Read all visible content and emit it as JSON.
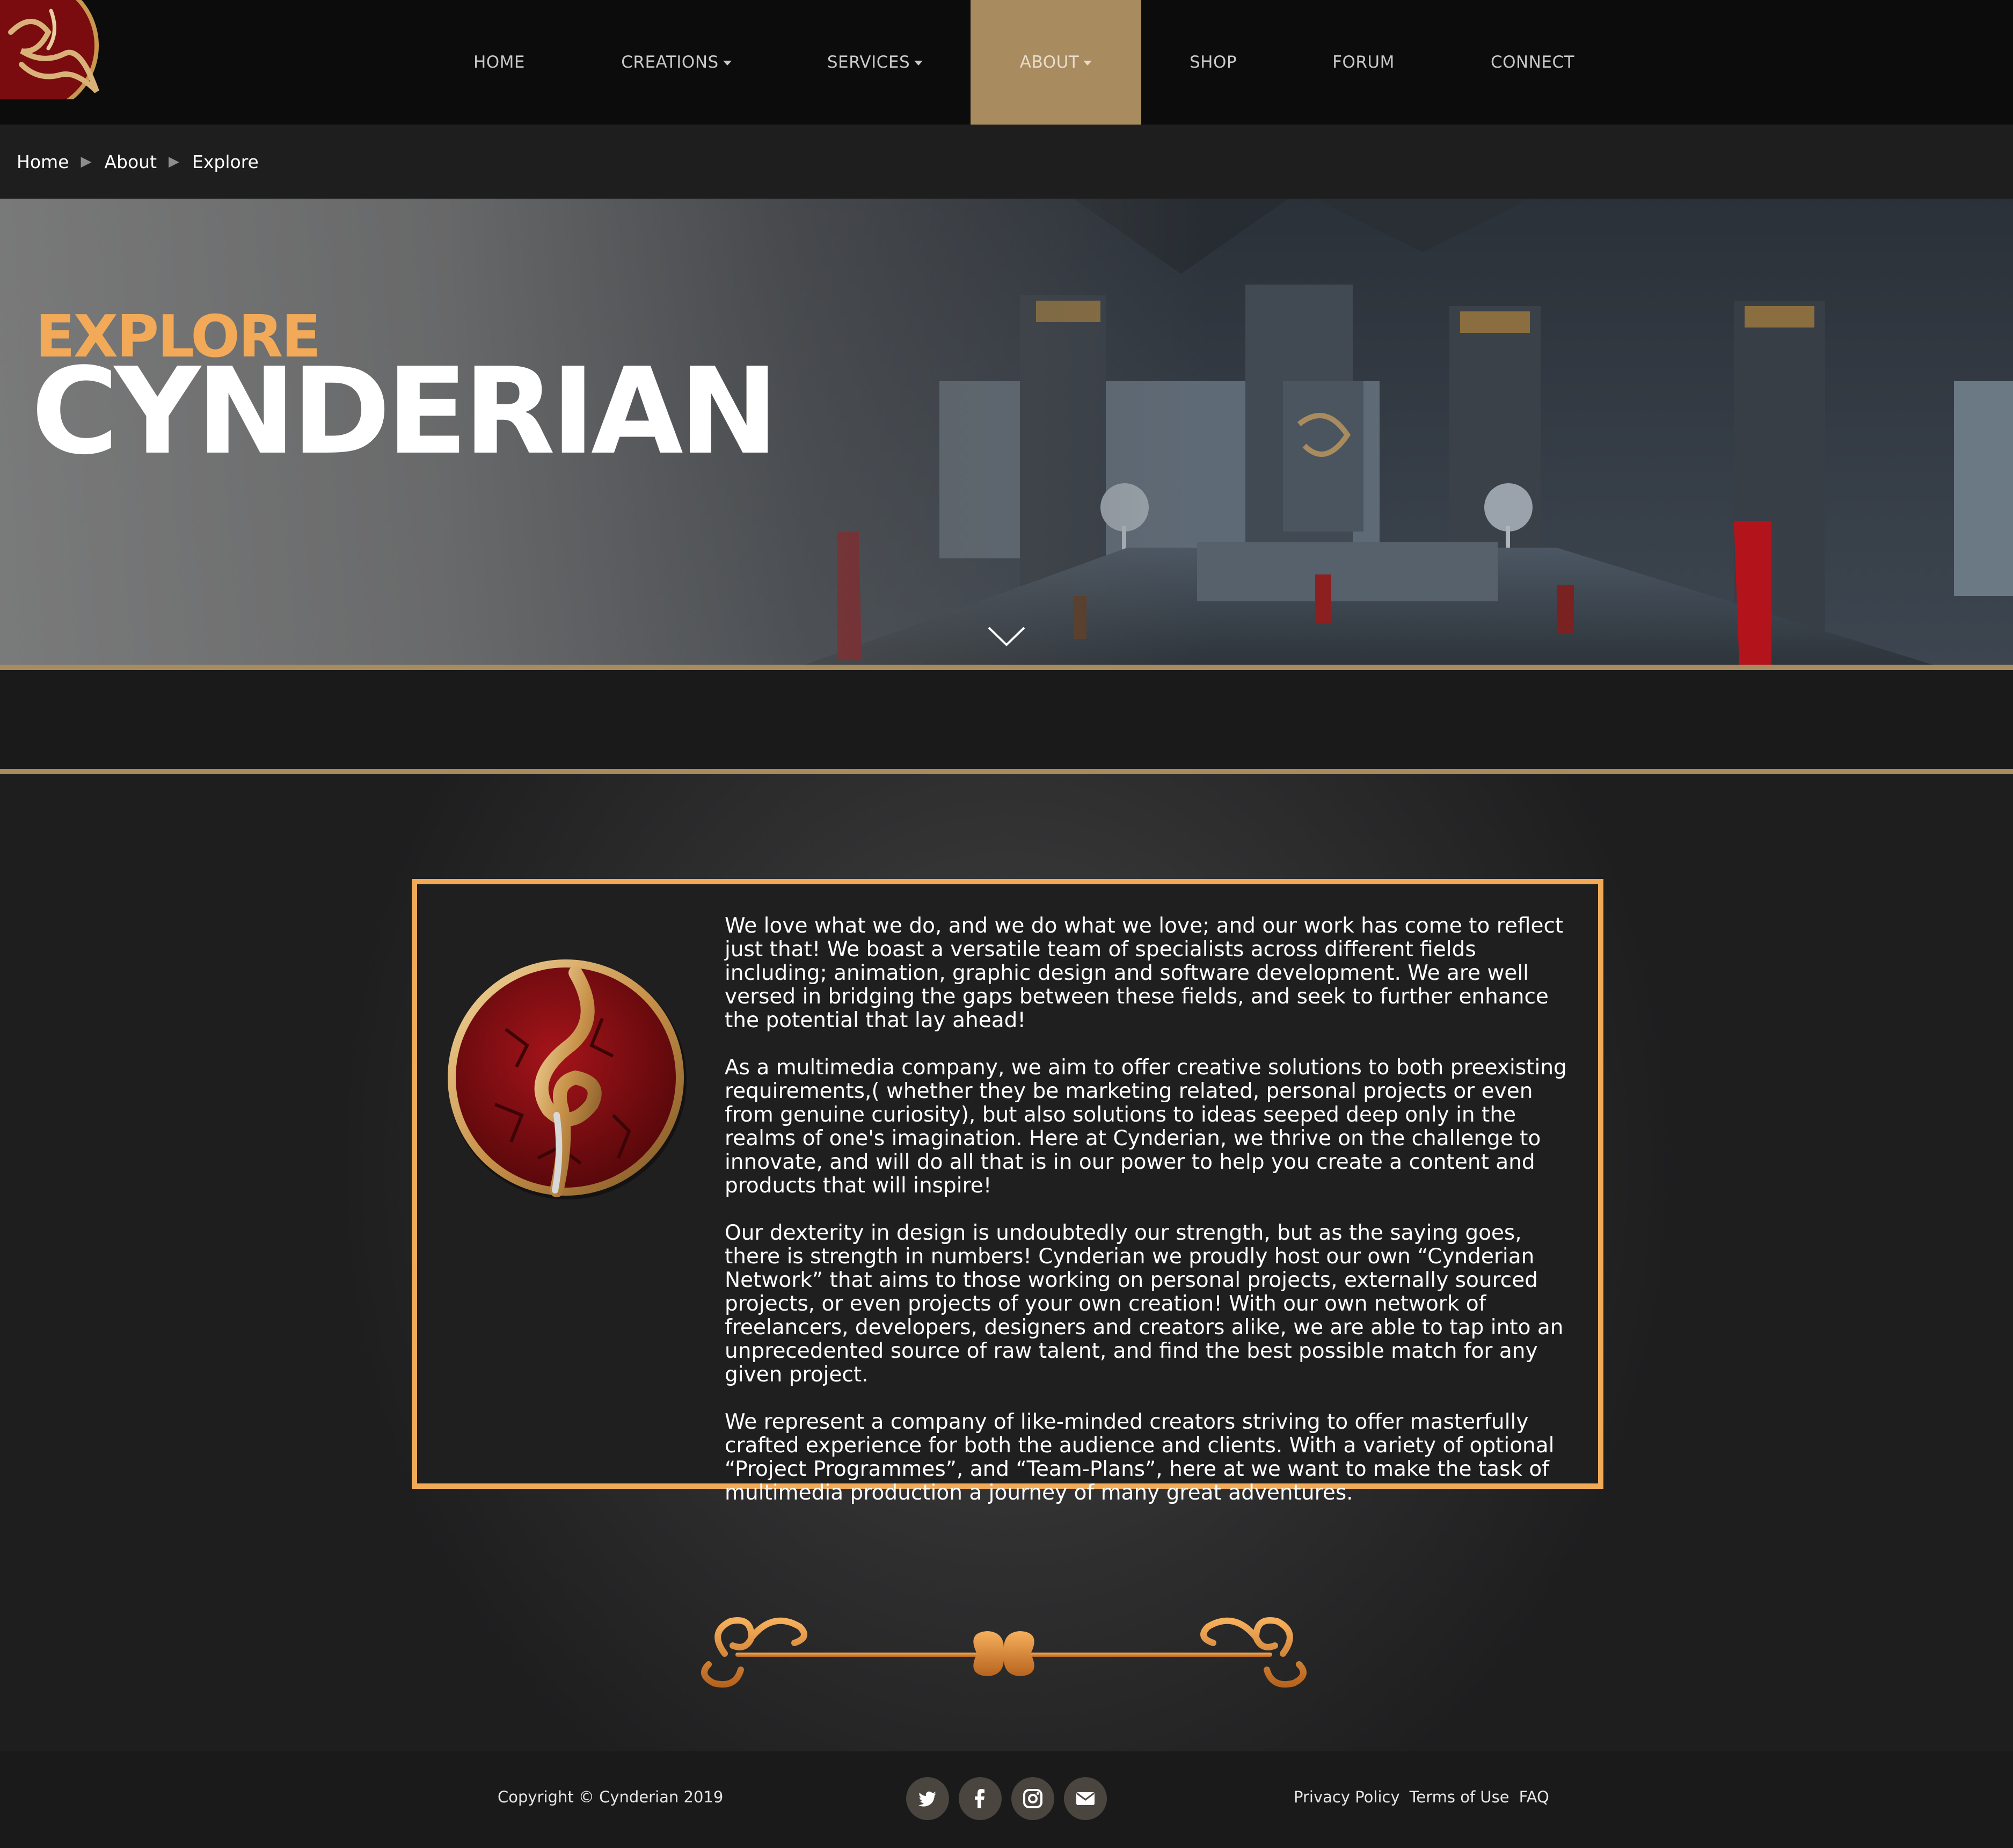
{
  "nav": {
    "items": [
      {
        "label": "HOME",
        "dropdown": false
      },
      {
        "label": "CREATIONS",
        "dropdown": true
      },
      {
        "label": "SERVICES",
        "dropdown": true
      },
      {
        "label": "ABOUT",
        "dropdown": true,
        "active": true
      },
      {
        "label": "SHOP",
        "dropdown": false
      },
      {
        "label": "FORUM",
        "dropdown": false
      },
      {
        "label": "CONNECT",
        "dropdown": false
      }
    ]
  },
  "breadcrumb": [
    "Home",
    "About",
    "Explore"
  ],
  "hero": {
    "kicker": "EXPLORE",
    "title": "CYNDERIAN"
  },
  "about": {
    "paragraphs": [
      "We love what we do, and we do what we love; and our work has come to reflect just that! We boast a versatile team of specialists across different fields including; animation, graphic design and software development. We are well versed in bridging the gaps between these fields, and seek to further enhance the potential that lay ahead!",
      "As a multimedia company, we aim to offer creative solutions to both preexisting requirements,( whether they be marketing related, personal projects or even from genuine curiosity), but also solutions to ideas seeped deep only in the realms of one's imagination. Here at Cynderian, we thrive on the challenge to innovate, and will do all that is in our power to help you create a content and products that will inspire!",
      "Our dexterity in design is undoubtedly our strength, but as the saying goes, there is strength in numbers! Cynderian we proudly host our own “Cynderian Network” that aims to those working on personal projects, externally sourced projects, or even projects of your own creation! With our own network of freelancers, developers, designers and creators alike, we are able to tap into an unprecedented source of raw talent, and find the best possible match for any given project.",
      "We represent a company of like-minded creators striving to offer masterfully crafted experience for both the audience and clients. With a variety of optional “Project Programmes”, and “Team-Plans”, here at we want to make the task of multimedia production a journey of many great adventures."
    ]
  },
  "footer": {
    "copyright": "Copyright © Cynderian 2019",
    "social": [
      "twitter-icon",
      "facebook-icon",
      "instagram-icon",
      "email-icon"
    ],
    "links": [
      "Privacy Policy",
      "Terms of Use",
      "FAQ"
    ]
  },
  "colors": {
    "accent_gold": "#a88b5f",
    "accent_orange": "#f2aa58",
    "emblem_red": "#8a0f12"
  }
}
